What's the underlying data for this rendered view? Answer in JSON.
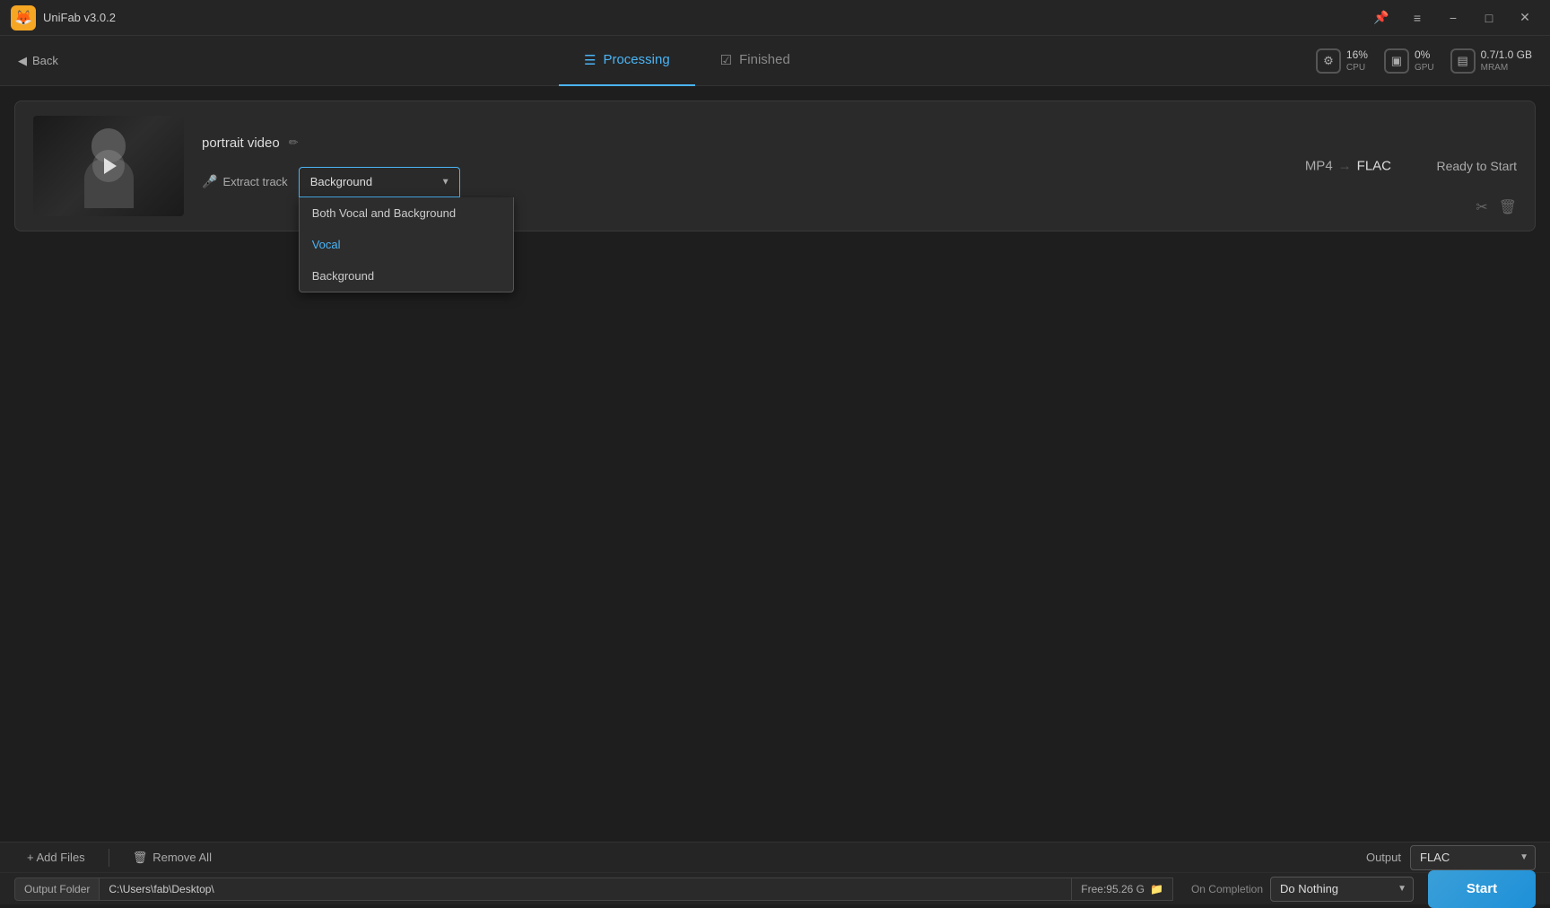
{
  "app": {
    "title": "UniFab v3.0.2",
    "logo": "🦊"
  },
  "titlebar": {
    "pin_label": "📌",
    "menu_label": "≡",
    "minimize_label": "−",
    "maximize_label": "□",
    "close_label": "✕"
  },
  "nav": {
    "back_label": "Back",
    "processing_label": "Processing",
    "finished_label": "Finished",
    "cpu_value": "16%",
    "cpu_label": "CPU",
    "gpu_value": "0%",
    "gpu_label": "GPU",
    "mram_value": "0.7/1.0 GB",
    "mram_label": "MRAM"
  },
  "task": {
    "name": "portrait video",
    "format_from": "MP4",
    "format_to": "FLAC",
    "status": "Ready to Start",
    "extract_track_label": "Extract track",
    "selected_option": "Background"
  },
  "dropdown": {
    "options": [
      {
        "label": "Both Vocal and Background",
        "value": "both",
        "active": false
      },
      {
        "label": "Vocal",
        "value": "vocal",
        "active": true
      },
      {
        "label": "Background",
        "value": "background",
        "active": false
      }
    ]
  },
  "bottom": {
    "add_files_label": "+ Add Files",
    "remove_all_label": "Remove All",
    "output_label": "Output",
    "output_value": "FLAC",
    "folder_label": "Output Folder",
    "folder_path": "C:\\Users\\fab\\Desktop\\",
    "free_space": "Free:95.26 G",
    "on_completion_label": "On Completion",
    "completion_value": "Do Nothing",
    "start_label": "Start"
  }
}
